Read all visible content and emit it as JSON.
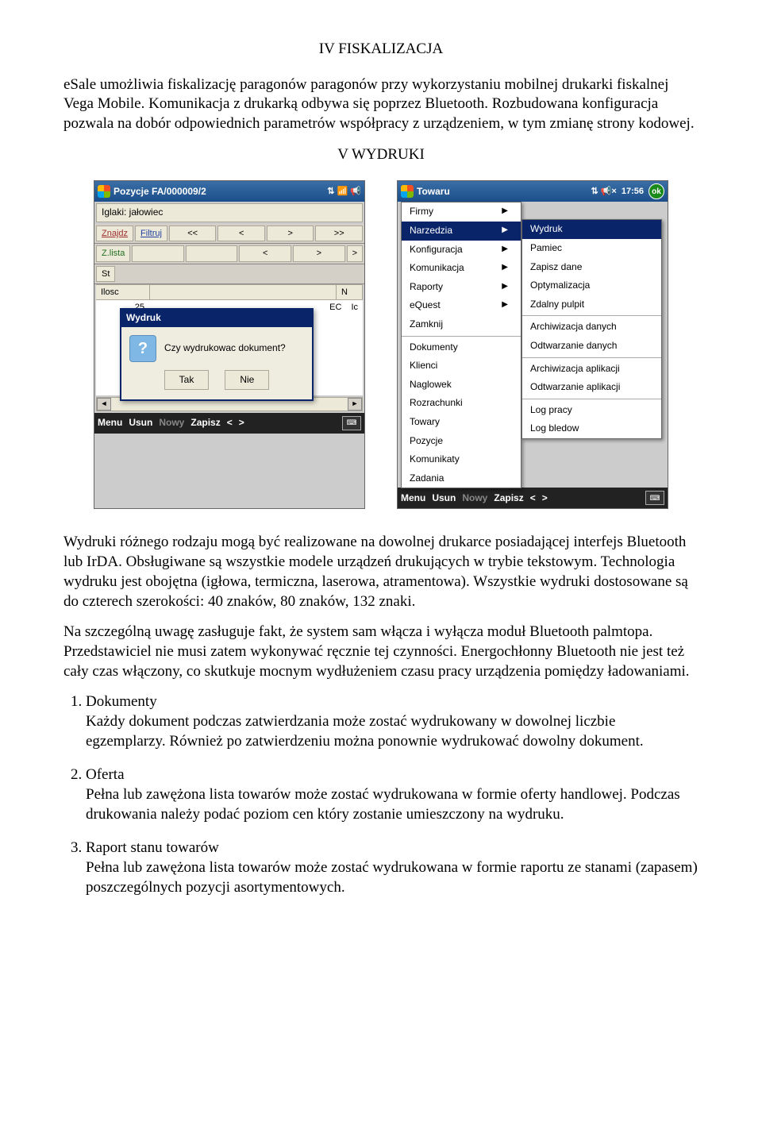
{
  "section1_title": "IV FISKALIZACJA",
  "para1": "eSale umożliwia fiskalizację paragonów paragonów przy wykorzystaniu mobilnej drukarki fiskalnej Vega Mobile. Komunikacja z drukarką odbywa się poprzez Bluetooth. Rozbudowana konfiguracja pozwala na dobór odpowiednich parametrów współpracy z urządzeniem, w tym zmianę strony kodowej.",
  "section2_title": "V WYDRUKI",
  "pda1": {
    "title": "Pozycje FA/000009/2",
    "status_icons": "⇅ 📶 📢",
    "item_label": "Iglaki: jałowiec",
    "tb_row1": [
      "Znajdz",
      "Filtruj",
      "<<",
      "<",
      ">",
      ">>"
    ],
    "tb_row2": [
      "Z.lista",
      "",
      "",
      "<",
      ">",
      ">"
    ],
    "tb_row3": [
      "St"
    ],
    "grid_headers": [
      "Ilosc",
      "N"
    ],
    "grid_row": [
      "25",
      "EC",
      "Ic"
    ],
    "dialog_title": "Wydruk",
    "dialog_text": "Czy wydrukowac dokument?",
    "dialog_yes": "Tak",
    "dialog_no": "Nie",
    "bottombar": [
      "Menu",
      "Usun",
      "Nowy",
      "Zapisz",
      "<",
      ">"
    ]
  },
  "pda2": {
    "title_partial": "Towaru",
    "time": "17:56",
    "status_icons": "⇅ 📢×",
    "menu1": [
      {
        "label": "Firmy",
        "arrow": true,
        "sel": false
      },
      {
        "label": "Narzedzia",
        "arrow": true,
        "sel": true
      },
      {
        "label": "Konfiguracja",
        "arrow": true,
        "sel": false
      },
      {
        "label": "Komunikacja",
        "arrow": true,
        "sel": false
      },
      {
        "label": "Raporty",
        "arrow": true,
        "sel": false
      },
      {
        "label": "eQuest",
        "arrow": true,
        "sel": false
      },
      {
        "label": "Zamknij",
        "arrow": false,
        "sel": false
      },
      {
        "sep": true
      },
      {
        "label": "Dokumenty",
        "arrow": false,
        "sel": false
      },
      {
        "label": "Klienci",
        "arrow": false,
        "sel": false
      },
      {
        "label": "Naglowek",
        "arrow": false,
        "sel": false
      },
      {
        "label": "Rozrachunki",
        "arrow": false,
        "sel": false
      },
      {
        "label": "Towary",
        "arrow": false,
        "sel": false
      },
      {
        "label": "Pozycje",
        "arrow": false,
        "sel": false
      },
      {
        "label": "Komunikaty",
        "arrow": false,
        "sel": false
      },
      {
        "label": "Zadania",
        "arrow": false,
        "sel": false
      }
    ],
    "menu2": [
      {
        "label": "Wydruk",
        "sel": true
      },
      {
        "label": "Pamiec"
      },
      {
        "label": "Zapisz dane"
      },
      {
        "label": "Optymalizacja"
      },
      {
        "label": "Zdalny pulpit"
      },
      {
        "sep": true
      },
      {
        "label": "Archiwizacja danych"
      },
      {
        "label": "Odtwarzanie danych"
      },
      {
        "sep": true
      },
      {
        "label": "Archiwizacja aplikacji"
      },
      {
        "label": "Odtwarzanie aplikacji"
      },
      {
        "sep": true
      },
      {
        "label": "Log pracy"
      },
      {
        "label": "Log bledow"
      }
    ],
    "bottombar": [
      "Menu",
      "Usun",
      "Nowy",
      "Zapisz",
      "<",
      ">"
    ]
  },
  "para2": "Wydruki różnego rodzaju mogą być realizowane na dowolnej drukarce posiadającej interfejs Bluetooth lub IrDA. Obsługiwane są wszystkie modele urządzeń drukujących w trybie tekstowym. Technologia wydruku jest obojętna (igłowa, termiczna, laserowa, atramentowa). Wszystkie wydruki dostosowane są do czterech szerokości: 40 znaków, 80 znaków, 132 znaki.",
  "para3": "Na szczególną uwagę zasługuje fakt, że system sam włącza i wyłącza moduł Bluetooth palmtopa. Przedstawiciel nie musi zatem wykonywać ręcznie tej czynności. Energochłonny Bluetooth nie jest też cały czas włączony, co skutkuje mocnym wydłużeniem czasu pracy urządzenia pomiędzy ładowaniami.",
  "list": [
    {
      "title": "Dokumenty",
      "body": "Każdy dokument podczas zatwierdzania może zostać wydrukowany w dowolnej liczbie egzemplarzy. Również po zatwierdzeniu można ponownie wydrukować dowolny dokument."
    },
    {
      "title": "Oferta",
      "body": "Pełna lub zawężona lista towarów może zostać wydrukowana w formie oferty handlowej. Podczas drukowania należy podać poziom cen który zostanie umieszczony na wydruku."
    },
    {
      "title": "Raport stanu towarów",
      "body": "Pełna lub zawężona lista towarów może zostać wydrukowana w formie raportu ze stanami (zapasem) poszczególnych pozycji asortymentowych."
    }
  ]
}
